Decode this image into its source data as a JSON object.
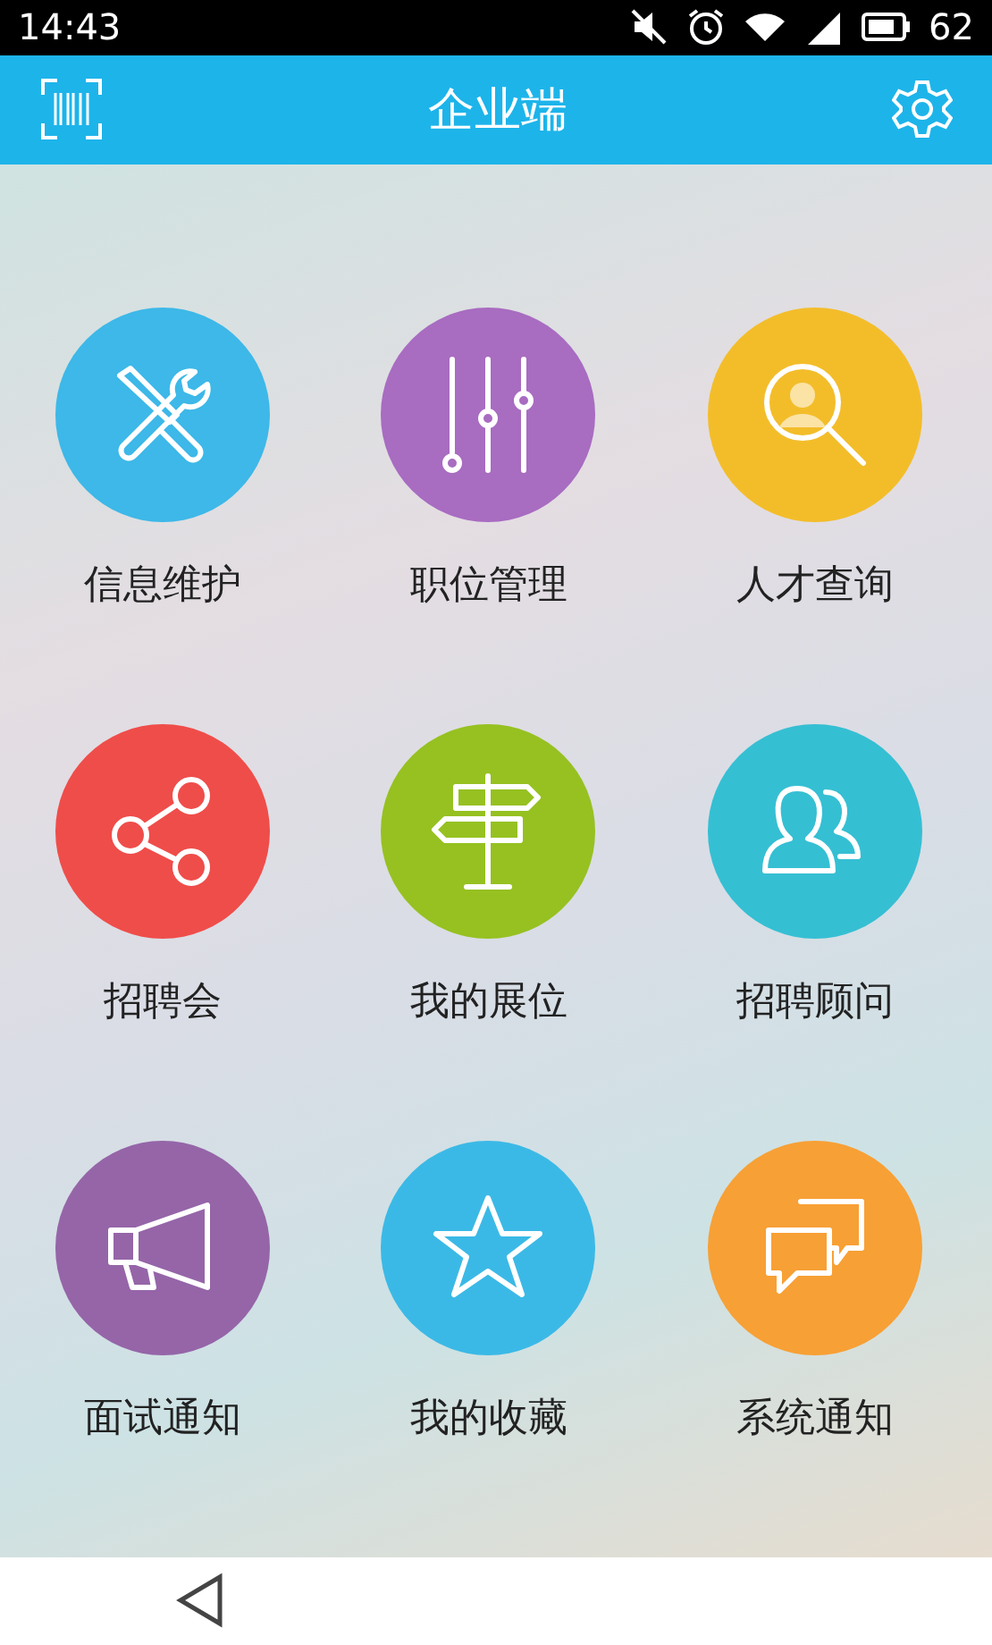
{
  "status_bar": {
    "time": "14:43",
    "battery": "62"
  },
  "header": {
    "title": "企业端"
  },
  "menu": [
    {
      "label": "信息维护",
      "kind": "tools",
      "color": "#3db8e8"
    },
    {
      "label": "职位管理",
      "kind": "sliders",
      "color": "#a86cc1"
    },
    {
      "label": "人才查询",
      "kind": "search",
      "color": "#f3bd2a"
    },
    {
      "label": "招聘会",
      "kind": "share",
      "color": "#ef4d4a"
    },
    {
      "label": "我的展位",
      "kind": "signpost",
      "color": "#96c121"
    },
    {
      "label": "招聘顾问",
      "kind": "people",
      "color": "#35bfd3"
    },
    {
      "label": "面试通知",
      "kind": "megaphone",
      "color": "#9565a8"
    },
    {
      "label": "我的收藏",
      "kind": "star",
      "color": "#3bb9e6"
    },
    {
      "label": "系统通知",
      "kind": "chat",
      "color": "#f7a035"
    }
  ]
}
